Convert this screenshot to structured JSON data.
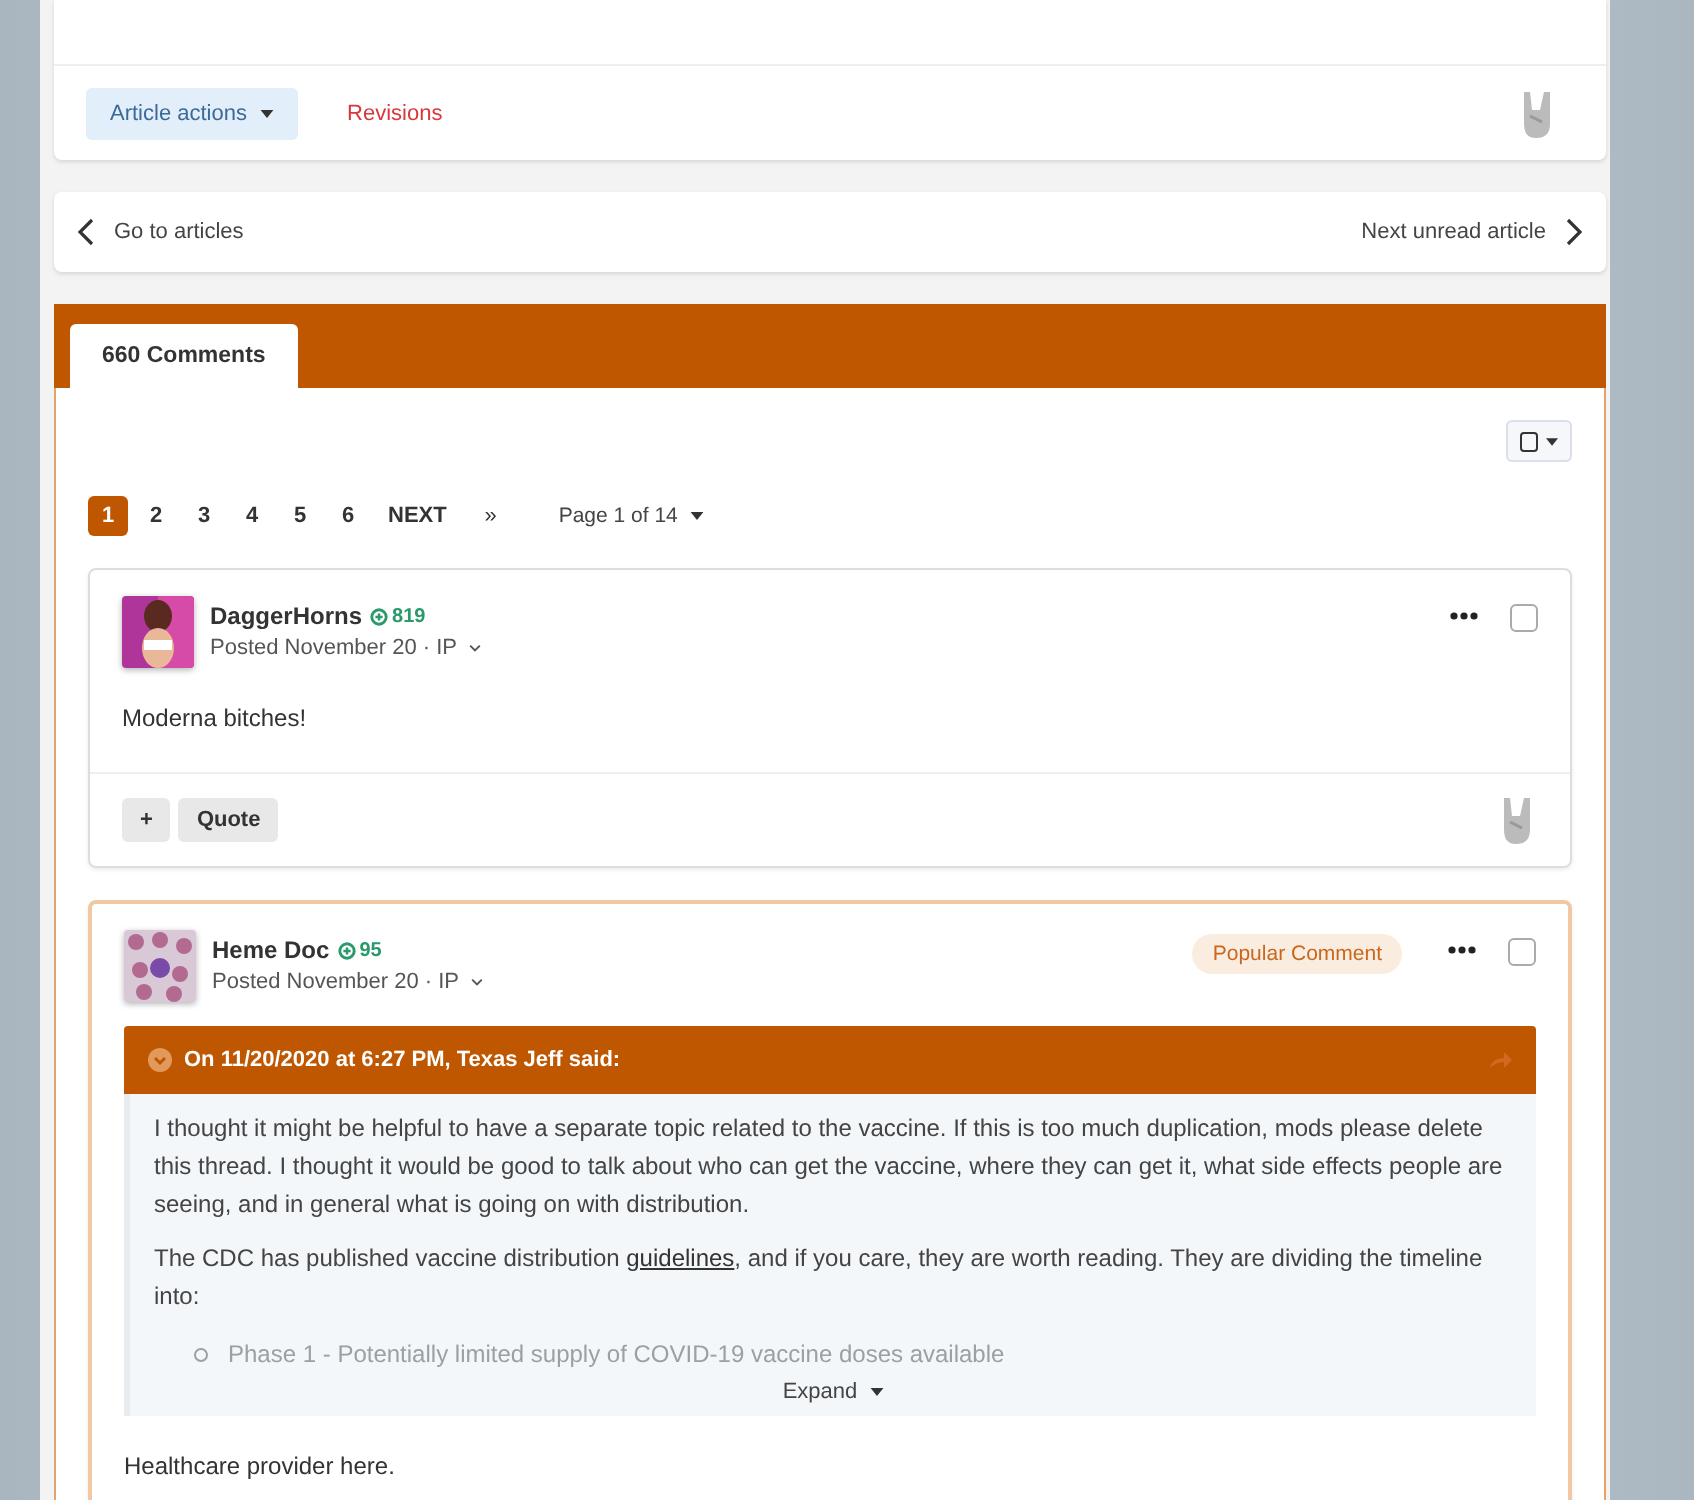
{
  "article_actions": {
    "menu_button": "Article actions",
    "revisions_link": "Revisions"
  },
  "navigation": {
    "back": "Go to articles",
    "next": "Next unread article"
  },
  "comments_tab": {
    "label": "660 Comments",
    "selected": true
  },
  "pagination": {
    "pages": [
      {
        "label": "1",
        "selected": true
      },
      {
        "label": "2",
        "selected": false
      },
      {
        "label": "3",
        "selected": false
      },
      {
        "label": "4",
        "selected": false
      },
      {
        "label": "5",
        "selected": false
      },
      {
        "label": "6",
        "selected": false
      }
    ],
    "next": "NEXT",
    "last": "»",
    "page_menu": "Page 1 of 14"
  },
  "comments": [
    {
      "author": "DaggerHorns",
      "reputation": "819",
      "posted": "Posted November 20 · IP",
      "popular": false,
      "checked": false,
      "body": "Moderna bitches!",
      "actions": {
        "plus": "+",
        "quote": "Quote"
      }
    },
    {
      "author": "Heme Doc",
      "reputation": "95",
      "posted": "Posted November 20 · IP",
      "badge": "Popular Comment",
      "popular": true,
      "checked": false,
      "quote": {
        "header": "On 11/20/2020 at 6:27 PM, Texas Jeff said:",
        "paragraphs": [
          {
            "before": "I thought it might be helpful to have a separate topic related to the vaccine.  If this is too much duplication, mods please delete this thread.  I thought it would be good to talk about who can get the vaccine, where they can get it, what side effects people are seeing, and in general what is going on with distribution."
          },
          {
            "before": "The CDC has published vaccine distribution ",
            "link": "guidelines",
            "after": ", and if you care, they are worth reading.  They are dividing the timeline into:"
          }
        ],
        "faded_item": "Phase 1 - Potentially limited supply of COVID-19 vaccine doses available",
        "expand": "Expand"
      },
      "body": "Healthcare provider here."
    }
  ]
}
